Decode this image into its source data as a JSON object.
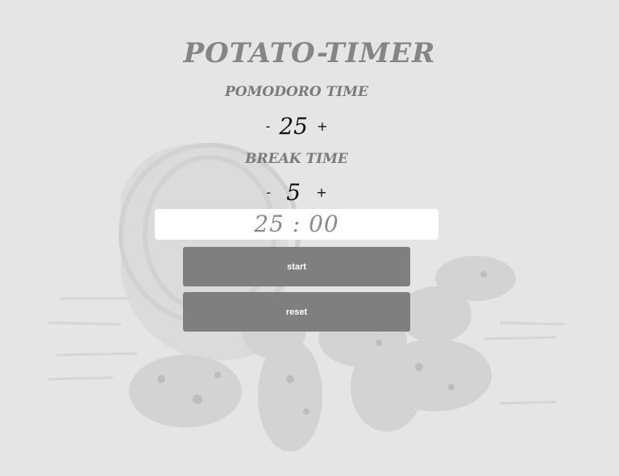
{
  "app": {
    "title": "POTATO-TIMER"
  },
  "pomodoro": {
    "label": "POMODORO TIME",
    "decrement": "-",
    "value": "25",
    "increment": "+"
  },
  "break": {
    "label": "BREAK TIME",
    "decrement": "-",
    "value": "5",
    "increment": "+"
  },
  "display": {
    "time": "25 : 00"
  },
  "controls": {
    "start_label": "start",
    "reset_label": "reset"
  },
  "colors": {
    "background": "#e5e5e5",
    "button": "#7f7f7f",
    "title": "#858585"
  },
  "background_image": {
    "icon": "potato-basket-illustration"
  }
}
